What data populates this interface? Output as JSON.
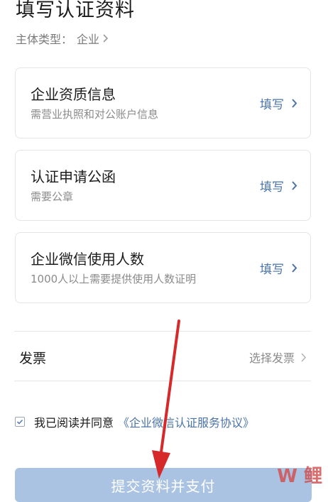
{
  "page": {
    "title": "填写认证资料",
    "subject_type_label": "主体类型：",
    "subject_type_value": "企业"
  },
  "cards": [
    {
      "title": "企业资质信息",
      "desc": "需营业执照和对公账户信息",
      "action": "填写"
    },
    {
      "title": "认证申请公函",
      "desc": "需要公章",
      "action": "填写"
    },
    {
      "title": "企业微信使用人数",
      "desc": "1000人以上需要提供使用人数证明",
      "action": "填写"
    }
  ],
  "invoice": {
    "label": "发票",
    "action": "选择发票"
  },
  "agreement": {
    "checked": true,
    "text": "我已阅读并同意",
    "link": "《企业微信认证服务协议》"
  },
  "submit": {
    "label": "提交资料并支付"
  },
  "watermark": {
    "text": "W 鲤"
  },
  "colors": {
    "link_blue": "#4a73a8",
    "submit_bg": "#aac3e3",
    "annotation_red": "#d62a2a"
  },
  "icons": [
    "chevron-right-icon",
    "checkbox-checked-icon",
    "annotation-arrow"
  ]
}
